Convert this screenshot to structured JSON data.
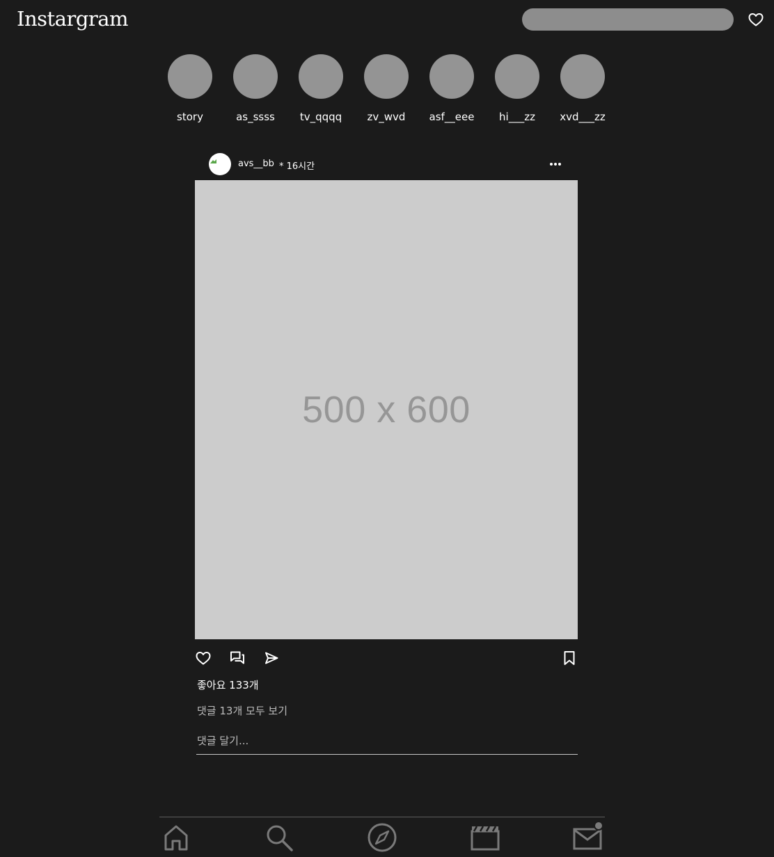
{
  "header": {
    "logo": "Instargram",
    "search_placeholder": "",
    "heart_icon": "heart-outline-icon"
  },
  "stories": [
    {
      "label": "story"
    },
    {
      "label": "as_ssss"
    },
    {
      "label": "tv_qqqq"
    },
    {
      "label": "zv_wvd"
    },
    {
      "label": "asf__eee"
    },
    {
      "label": "hi___zz"
    },
    {
      "label": "xvd___zz"
    }
  ],
  "post": {
    "username": "avs__bb",
    "time": "* 16시간",
    "image_placeholder": "500 x 600",
    "likes": "좋아요 133개",
    "view_comments": "댓글 13개 모두 보기",
    "comment_placeholder": "댓글 달기..."
  },
  "colors": {
    "background": "#1b1b1b",
    "story_avatar": "#949494",
    "search_bar": "#8d8d8d",
    "image_placeholder_bg": "#cccccc",
    "icon_gray": "#7a7a7a"
  },
  "bottom_nav": {
    "icons": [
      "home-icon",
      "search-icon",
      "compass-icon",
      "reels-icon",
      "mail-icon"
    ]
  }
}
